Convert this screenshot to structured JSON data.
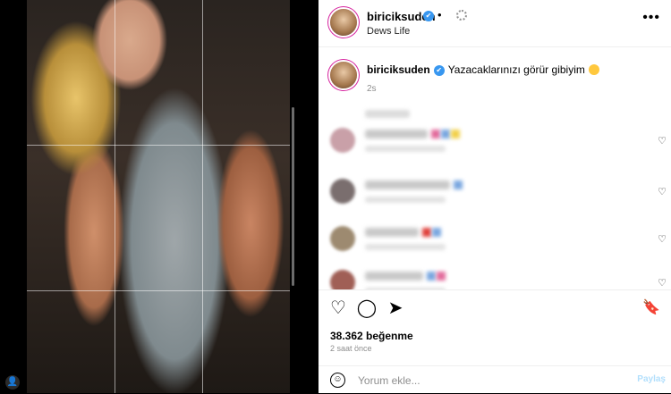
{
  "post": {
    "author": {
      "username": "biriciksuden",
      "verified_glyph": "✔",
      "subtitle": "Dews Life"
    },
    "separator": "•",
    "more_icon": "more-horizontal-icon",
    "more_glyph": "•••",
    "caption": {
      "username": "biriciksuden",
      "text": "Yazacaklarınızı görür gibiyim",
      "emoji_name": "laughing-face-emoji",
      "time": "2s"
    },
    "comments": [
      {
        "avatar_color": "#c9a0a8",
        "name_width": 70,
        "highlight": [
          "#e36c9c",
          "#7aa7e0",
          "#f2d14c"
        ]
      },
      {
        "avatar_color": "#7a6e6e",
        "name_width": 95,
        "highlight": [
          "#7aa7e0"
        ]
      },
      {
        "avatar_color": "#9d8a70",
        "name_width": 60,
        "highlight": [
          "#e0413b",
          "#7aa7e0"
        ]
      },
      {
        "avatar_color": "#a05f56",
        "name_width": 65,
        "highlight": [
          "#7aa7e0",
          "#e36c9c"
        ]
      }
    ],
    "comment_heart_glyph": "♡",
    "actions": {
      "like_glyph": "♡",
      "comment_glyph": "◯",
      "share_glyph": "➤",
      "save_glyph": "🔖"
    },
    "likes_text": "38.362 beğenme",
    "time_ago": "2 saat önce",
    "comment_box": {
      "emoji_glyph": "☺",
      "placeholder": "Yorum ekle...",
      "share_label": "Paylaş"
    },
    "user_tag_glyph": "👤"
  },
  "colors": {
    "verified": "#3897f0",
    "share_disabled": "#b2dffc",
    "story_ring": "#d6249f"
  }
}
